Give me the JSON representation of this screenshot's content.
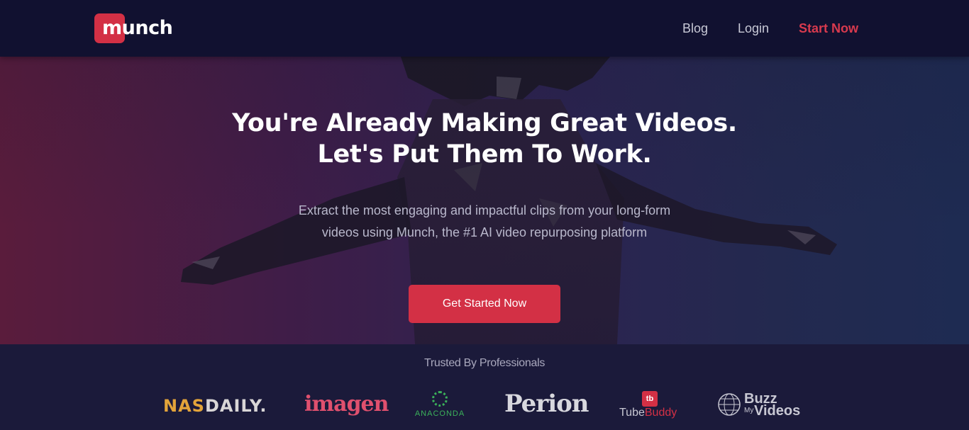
{
  "nav": {
    "logo_text": "munch",
    "links": [
      {
        "label": "Blog"
      },
      {
        "label": "Login"
      },
      {
        "label": "Start Now"
      }
    ]
  },
  "hero": {
    "headline_line1": "You're Already Making Great Videos.",
    "headline_line2": "Let's Put Them To Work.",
    "sub_line1": "Extract the most engaging and impactful clips from your long-form",
    "sub_line2": "videos using Munch, the #1 AI video repurposing platform",
    "cta_label": "Get Started Now"
  },
  "trusted": {
    "title": "Trusted By Professionals",
    "brands": {
      "nasdaily_a": "NAS",
      "nasdaily_b": "DAILY.",
      "imagen": "imagen",
      "anaconda": "ANACONDA",
      "perion": "Perion",
      "tubebuddy_badge": "tb",
      "tubebuddy_a": "Tube",
      "tubebuddy_b": "Buddy",
      "buzz_top": "Buzz",
      "buzz_my": "My",
      "buzz_videos": "Videos"
    }
  },
  "colors": {
    "accent": "#d33045",
    "nav_bg": "#111130",
    "trusted_bg": "#1b1a3a"
  }
}
